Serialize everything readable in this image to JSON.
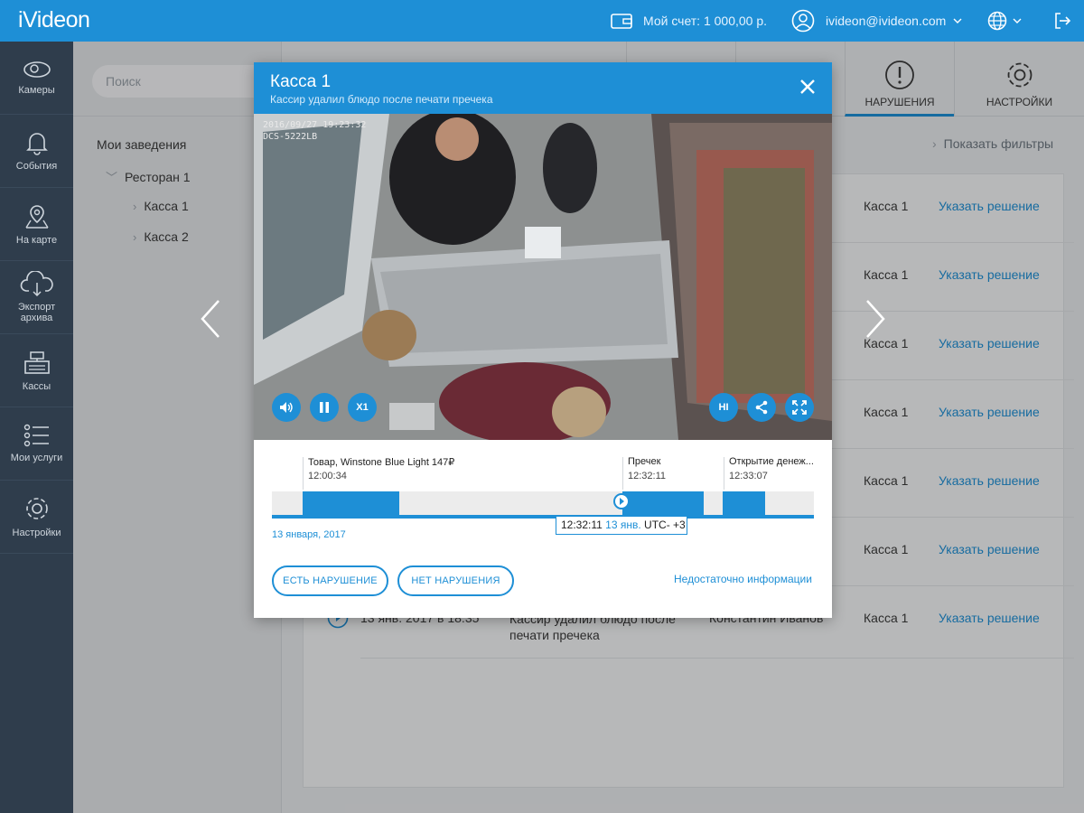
{
  "topbar": {
    "logo": "iVideon",
    "account": "Мой счет: 1 000,00 р.",
    "user": "ivideon@ivideon.com"
  },
  "sidebar": {
    "items": [
      {
        "label": "Камеры",
        "icon": "camera-icon"
      },
      {
        "label": "События",
        "icon": "bell-icon"
      },
      {
        "label": "На карте",
        "icon": "map-pin-icon"
      },
      {
        "label": "Экспорт архива",
        "icon": "cloud-download-icon"
      },
      {
        "label": "Кассы",
        "icon": "cash-register-icon"
      },
      {
        "label": "Мои услуги",
        "icon": "list-icon"
      },
      {
        "label": "Настройки",
        "icon": "gear-icon"
      }
    ]
  },
  "tree": {
    "search_placeholder": "Поиск",
    "root": "Мои заведения",
    "restaurant": "Ресторан 1",
    "items": [
      "Касса 1",
      "Касса 2"
    ]
  },
  "tabs": {
    "violations": "НАРУШЕНИЯ",
    "settings": "НАСТРОЙКИ"
  },
  "list": {
    "show_filters": "Показать фильтры",
    "rows": [
      {
        "cash": "Касса 1",
        "action": "Указать решение"
      },
      {
        "cash": "Касса 1",
        "action": "Указать решение"
      },
      {
        "cash": "Касса 1",
        "action": "Указать решение"
      },
      {
        "cash": "Касса 1",
        "action": "Указать решение"
      },
      {
        "cash": "Касса 1",
        "action": "Указать решение"
      },
      {
        "cash": "Касса 1",
        "action": "Указать решение"
      },
      {
        "cash": "Касса 1",
        "action": "Указать решение"
      }
    ],
    "last_row": {
      "date": "13 янв. 2017 в 18:35",
      "desc_line1": "Кассир удалил блюдо после",
      "desc_line2": "печати пречека",
      "person": "Константин Иванов"
    }
  },
  "modal": {
    "title": "Касса 1",
    "subtitle": "Кассир удалил блюдо после печати пречека",
    "osd_line1": "2016/09/27 19:23:32",
    "osd_line2": "DCS-5222LB",
    "speed": "X1",
    "quality": "HI",
    "events": [
      {
        "label": "Товар, Winstone Blue Light 147₽",
        "time": "12:00:34"
      },
      {
        "label": "Пречек",
        "time": "12:32:11"
      },
      {
        "label": "Открытие денеж...",
        "time": "12:33:07"
      }
    ],
    "timeline_date": "13 января, 2017",
    "tooltip_time": "12:32:11",
    "tooltip_date": "13 янв.",
    "tooltip_tz": "UTC- +3",
    "btn_yes": "ЕСТЬ НАРУШЕНИЕ",
    "btn_no": "НЕТ НАРУШЕНИЯ",
    "link_info": "Недостаточно информации"
  },
  "colors": {
    "accent": "#1e8fd6",
    "sidebar": "#2f3d4c"
  }
}
